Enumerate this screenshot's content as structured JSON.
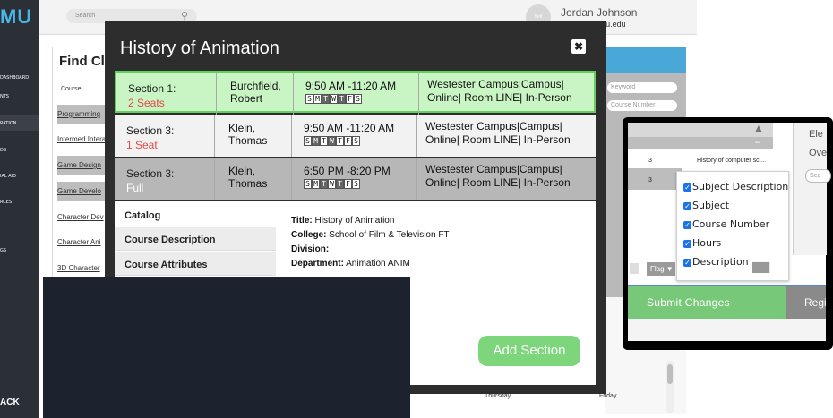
{
  "app": {
    "logo": "MU",
    "search_placeholder": "Search",
    "user_name": "Jordan Johnson",
    "user_email_partial": "jjohnson@mu.edu",
    "avatar_text": "Self",
    "sidebar_items": [
      "DASHBOARD",
      "NTS",
      "RATION",
      "DS",
      "IAL AID",
      "RCES",
      "GS"
    ],
    "back_label": "ACK"
  },
  "background": {
    "find_heading": "Find Cl",
    "course_header": "Course",
    "courses": [
      "Programming",
      "Intermed Intera",
      "Game Design",
      "Game Develo",
      "Character Dev",
      "Character Ani",
      "3D Character"
    ],
    "right_inputs": [
      "Keyword",
      "Course Number"
    ],
    "day_labels": [
      "Thursday",
      "Friday"
    ]
  },
  "modal": {
    "title": "History of Animation",
    "close_label": "✖",
    "sections": [
      {
        "name": "Section 1:",
        "seats": "2 Seats",
        "instructor_last": "Burchfield,",
        "instructor_first": "Robert",
        "time": "9:50 AM -11:20 AM",
        "days": [
          "S",
          "M",
          "T",
          "W",
          "T",
          "F",
          "S"
        ],
        "active_days": [
          2,
          4
        ],
        "location_line1": "Westester Campus|Campus|",
        "location_line2": "Online| Room LINE| In-Person"
      },
      {
        "name": "Section 3:",
        "seats": "1 Seat",
        "instructor_last": "Klein,",
        "instructor_first": "Thomas",
        "time": "9:50 AM -11:20 AM",
        "days": [
          "S",
          "M",
          "T",
          "W",
          "T",
          "F",
          "S"
        ],
        "active_days": [
          1,
          3
        ],
        "location_line1": "Westester Campus|Campus|",
        "location_line2": "Online| Room LINE| In-Person"
      },
      {
        "name": "Section 3:",
        "seats": "Full",
        "instructor_last": "Klein,",
        "instructor_first": "Thomas",
        "time": "6:50 PM -8:20 PM",
        "days": [
          "S",
          "M",
          "T",
          "W",
          "T",
          "F",
          "S"
        ],
        "active_days": [
          2,
          4
        ],
        "location_line1": "Westester Campus|Campus|",
        "location_line2": "Online| Room LINE| In-Person"
      }
    ],
    "tabs": [
      "Catalog",
      "Course Description",
      "Course Attributes"
    ],
    "info": {
      "title_label": "Title:",
      "title_value": "History of Animation",
      "college_label": "College:",
      "college_value": "School of Film & Television FT",
      "division_label": "Division:",
      "division_value": "",
      "department_label": "Department:",
      "department_value": "Animation ANIM"
    },
    "add_button": "Add Section"
  },
  "zoom": {
    "row_number_1": "3",
    "row_text_1": "History of computer sci...",
    "row_number_2": "3",
    "right_labels": [
      "Ele",
      "Ove"
    ],
    "right_input": "Sea",
    "options": [
      "Subject Description",
      "Subject",
      "Course Number",
      "Hours",
      "Description"
    ],
    "flag_label": "Flag",
    "submit_label": "Submit  Changes",
    "reg_label": "Regi"
  },
  "colors": {
    "row1_bg": "#c9f5c4",
    "row2_bg": "#f2f2f2",
    "row3_bg": "#b7b7b7",
    "seat_color": "#e54848",
    "add_button": "#7dd67b",
    "submit_button": "#78c879",
    "dark_overlay": "#1d232e"
  }
}
